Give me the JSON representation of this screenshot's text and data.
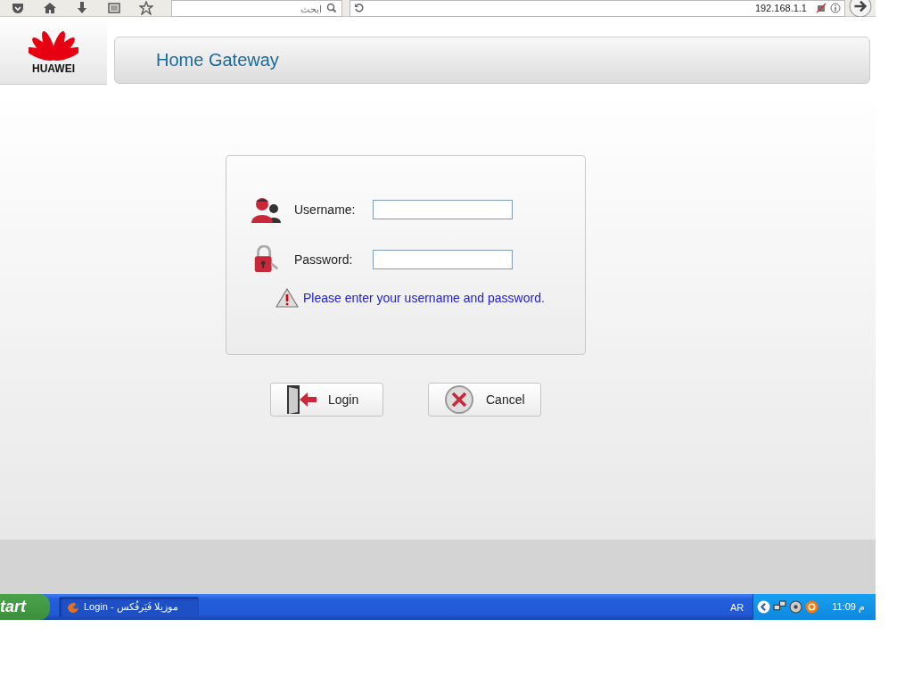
{
  "browser_toolbar": {
    "search": {
      "placeholder": "ابحث"
    },
    "address": "192.168.1.1"
  },
  "header": {
    "logo_text": "HUAWEI",
    "title": "Home Gateway"
  },
  "login_form": {
    "fields": [
      {
        "kind": "user",
        "label": "Username:"
      },
      {
        "kind": "password",
        "label": "Password:"
      }
    ],
    "message": "Please enter your username and password."
  },
  "buttons": [
    {
      "kind": "login",
      "label": "Login"
    },
    {
      "kind": "cancel",
      "label": "Cancel"
    }
  ],
  "taskbar": {
    "start": "tart",
    "tasks": [
      {
        "label": "Login - موزيلا فَيَرفُكس",
        "selected": true
      }
    ],
    "language": "AR",
    "clock": "11:09 م"
  }
}
